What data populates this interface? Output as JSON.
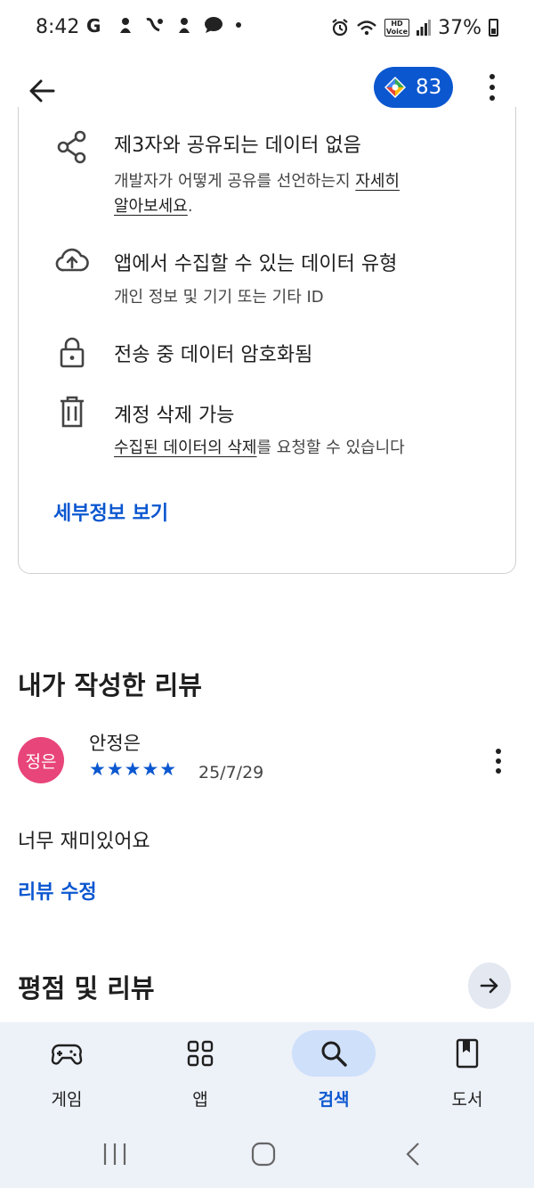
{
  "status_bar": {
    "time": "8:42",
    "notification_icons": "G",
    "battery": "37%"
  },
  "app_bar": {
    "points": "83"
  },
  "data_safety": {
    "rows": [
      {
        "icon": "share-icon",
        "title": "제3자와 공유되는 데이터 없음",
        "sub_text": "개발자가 어떻게 공유를 선언하는지 ",
        "sub_link": "자세히",
        "sub_line2_link": "알아보세요",
        "sub_line2_tail": "."
      },
      {
        "icon": "cloud-upload-icon",
        "title": "앱에서 수집할 수 있는 데이터 유형",
        "sub_text": "개인 정보 및 기기 또는 기타 ID"
      },
      {
        "icon": "lock-icon",
        "title": "전송 중 데이터 암호화됨"
      },
      {
        "icon": "trash-icon",
        "title": "계정 삭제 가능",
        "sub_link": "수집된 데이터의 삭제",
        "sub_tail": "를 요청할 수 있습니다"
      }
    ],
    "details_link": "세부정보 보기"
  },
  "my_review": {
    "title": "내가 작성한 리뷰",
    "avatar_text": "정은",
    "reviewer": "안정은",
    "rating": 5,
    "stars": "★★★★★",
    "date": "25/7/29",
    "text": "너무 재미있어요",
    "edit_link": "리뷰 수정"
  },
  "ratings_section": {
    "title": "평점 및 리뷰"
  },
  "bottom_nav": {
    "items": [
      {
        "label": "게임",
        "icon": "gamepad-icon",
        "active": false
      },
      {
        "label": "앱",
        "icon": "apps-grid-icon",
        "active": false
      },
      {
        "label": "검색",
        "icon": "search-icon",
        "active": true
      },
      {
        "label": "도서",
        "icon": "book-icon",
        "active": false
      }
    ]
  },
  "colors": {
    "accent": "#0b57d0",
    "avatar": "#e8457a",
    "nav_background": "#edf1f8",
    "active_pill": "#cfe0fb"
  }
}
